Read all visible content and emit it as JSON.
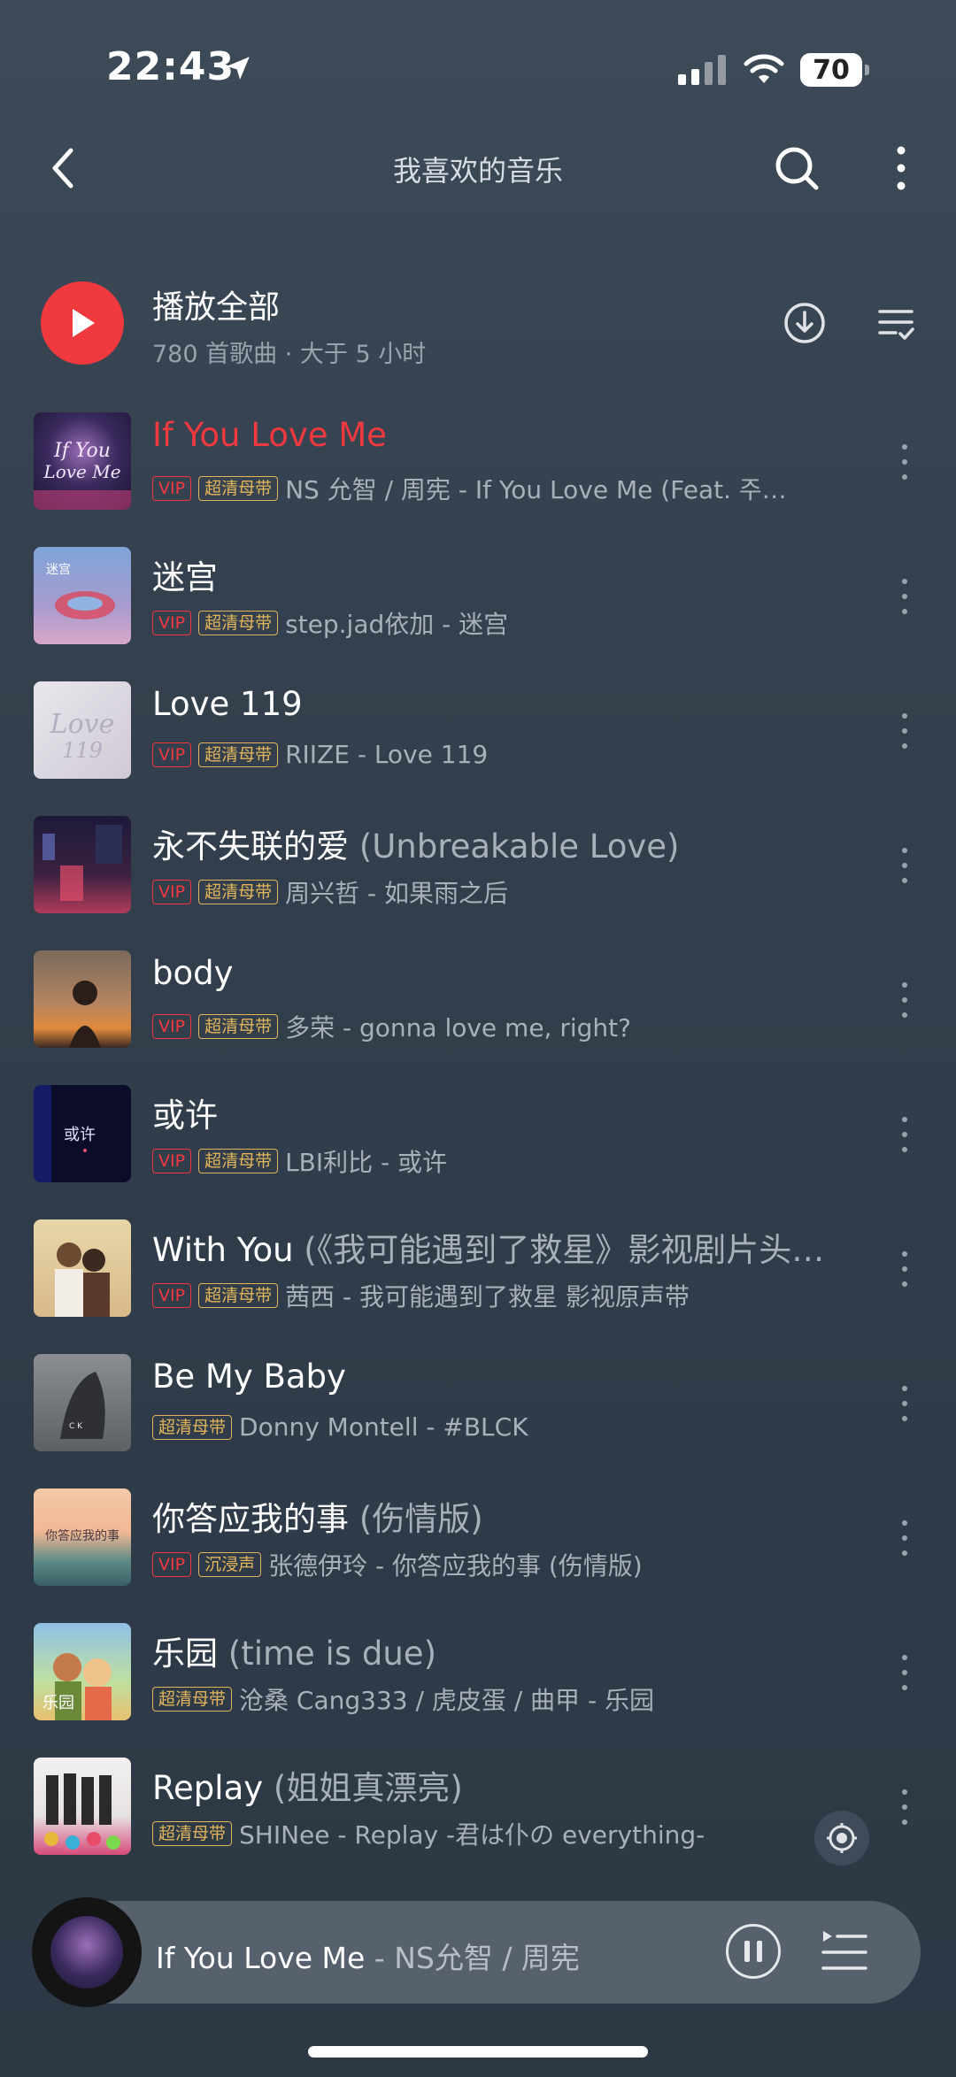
{
  "status_bar": {
    "time": "22:43",
    "battery": "70"
  },
  "nav": {
    "title": "我喜欢的音乐"
  },
  "play_all": {
    "label": "播放全部",
    "subtitle": "780 首歌曲 · 大于 5 小时"
  },
  "songs": [
    {
      "title": "If You Love Me",
      "suffix": "",
      "badges": [
        "VIP",
        "超清母带"
      ],
      "artist": "NS 允智 / 周宪 - If You Love Me (Feat. 주헌…",
      "active": true
    },
    {
      "title": "迷宫",
      "suffix": "",
      "badges": [
        "VIP",
        "超清母带"
      ],
      "artist": "step.jad依加 - 迷宫"
    },
    {
      "title": "Love 119",
      "suffix": "",
      "badges": [
        "VIP",
        "超清母带"
      ],
      "artist": "RIIZE - Love 119"
    },
    {
      "title": "永不失联的爱",
      "suffix": " (Unbreakable Love)",
      "badges": [
        "VIP",
        "超清母带"
      ],
      "artist": "周兴哲 - 如果雨之后"
    },
    {
      "title": "body",
      "suffix": "",
      "badges": [
        "VIP",
        "超清母带"
      ],
      "artist": "多荣 - gonna love me, right?"
    },
    {
      "title": "或许",
      "suffix": "",
      "badges": [
        "VIP",
        "超清母带"
      ],
      "artist": "LBI利比 - 或许"
    },
    {
      "title": "With You",
      "suffix": " (《我可能遇到了救星》影视剧片头…",
      "badges": [
        "VIP",
        "超清母带"
      ],
      "artist": "茜西 - 我可能遇到了救星 影视原声带"
    },
    {
      "title": "Be My Baby",
      "suffix": "",
      "badges": [
        "超清母带"
      ],
      "artist": "Donny Montell - #BLCK"
    },
    {
      "title": "你答应我的事",
      "suffix": " (伤情版)",
      "badges": [
        "VIP",
        "沉浸声"
      ],
      "artist": "张德伊玲 - 你答应我的事 (伤情版)"
    },
    {
      "title": "乐园",
      "suffix": " (time is due)",
      "badges": [
        "超清母带"
      ],
      "artist": "沧桑 Cang333 / 虎皮蛋 / 曲甲 - 乐园"
    },
    {
      "title": "Replay",
      "suffix": " (姐姐真漂亮)",
      "badges": [
        "超清母带"
      ],
      "artist": "SHINee - Replay -君は仆の everything-"
    }
  ],
  "mini_player": {
    "title": "If You Love Me",
    "separator": " - ",
    "artist": "NS允智 / 周宪"
  },
  "colors": {
    "accent": "#f0393f",
    "gold_badge": "#e2b45b"
  },
  "icons": [
    "location-arrow-icon",
    "wifi-icon",
    "back-icon",
    "search-icon",
    "more-vertical-icon",
    "play-icon",
    "download-icon",
    "playlist-manage-icon",
    "locate-icon",
    "pause-icon",
    "queue-icon"
  ]
}
